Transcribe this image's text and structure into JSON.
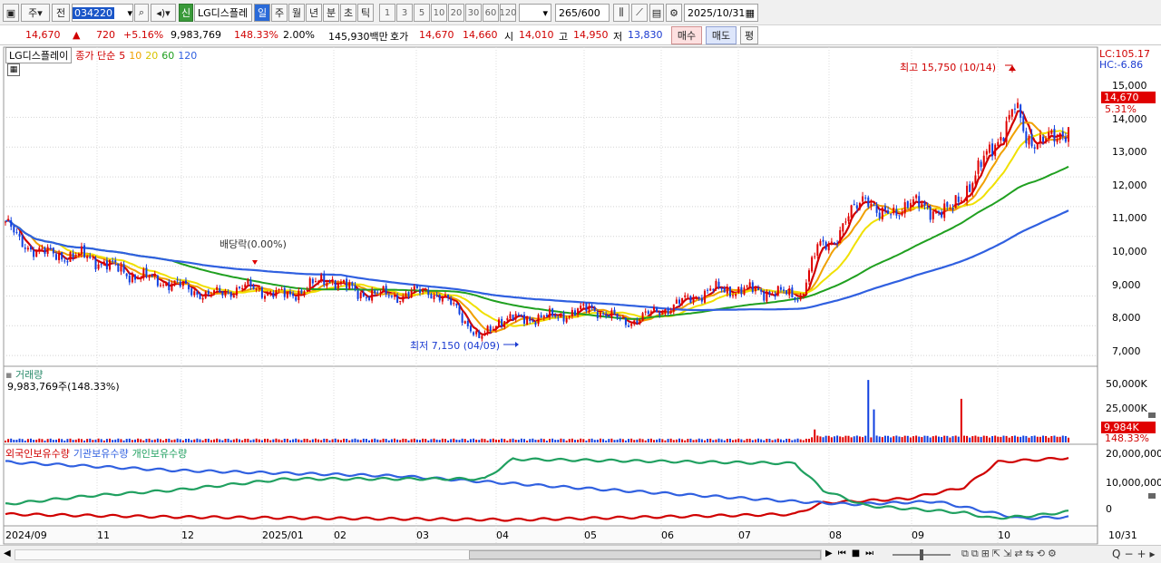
{
  "toolbar": {
    "period": "주",
    "prev": "전",
    "code": "034220",
    "name": "LG디스플레",
    "new_badge": "신",
    "periods": [
      "일",
      "주",
      "월",
      "년",
      "분",
      "초",
      "틱"
    ],
    "minutes": [
      "1",
      "3",
      "5",
      "10",
      "20",
      "30",
      "60",
      "120"
    ],
    "count": "265",
    "count_max": "/600",
    "date": "2025/10/31"
  },
  "quote": {
    "price": "14,670",
    "change_arrow": "▲",
    "change": "720",
    "change_pct": "+5.16%",
    "volume": "9,983,769",
    "vol_ratio": "148.33%",
    "turnover": "2.00%",
    "amount": "145,930백만",
    "ask_label": "호가",
    "ask": "14,670",
    "bid": "14,660",
    "open_label": "시",
    "open": "14,010",
    "high_label": "고",
    "high": "14,950",
    "low_label": "저",
    "low": "13,830",
    "buy": "매수",
    "sell": "매도",
    "avg": "평"
  },
  "price_panel": {
    "title": "LG디스플레이",
    "ma_label": "종가 단순",
    "ma_periods": [
      "5",
      "10",
      "20",
      "60",
      "120"
    ],
    "ma_colors": [
      "#d00000",
      "#f0a000",
      "#f0e000",
      "#20a020",
      "#3060e0"
    ],
    "lc": "LC:105.17",
    "hc": "HC:-6.86",
    "max_label": "최고 15,750 (10/14)",
    "min_label": "최저 7,150 (04/09)",
    "dividend_label": "배당락(0.00%)",
    "last_price": "14,670",
    "last_pct": "5.31%",
    "y_ticks": [
      "15,000",
      "14,000",
      "13,000",
      "12,000",
      "11,000",
      "10,000",
      "9,000",
      "8,000",
      "7,000"
    ]
  },
  "volume_panel": {
    "title": "거래량",
    "value": "9,983,769주(148.33%)",
    "y_ticks": [
      "50,000K",
      "25,000K",
      "0"
    ],
    "last": "9,984K",
    "last_pct": "148.33%"
  },
  "holding_panel": {
    "legend": [
      "외국인보유수량",
      "기관보유수량",
      "개인보유수량"
    ],
    "colors": [
      "#d00000",
      "#3060e0",
      "#20a060"
    ],
    "y_ticks": [
      "20,000,000",
      "10,000,000",
      "0"
    ]
  },
  "x_axis": {
    "labels": [
      "2024/09",
      "11",
      "12",
      "2025/01",
      "02",
      "03",
      "04",
      "05",
      "06",
      "07",
      "08",
      "09",
      "10",
      "10/31"
    ]
  },
  "chart_data": {
    "type": "candlestick",
    "price_range": [
      6700,
      16200
    ],
    "anchors": [
      [
        0,
        11500
      ],
      [
        5,
        10800
      ],
      [
        15,
        10400
      ],
      [
        30,
        10300
      ],
      [
        45,
        9700
      ],
      [
        60,
        9400
      ],
      [
        72,
        9000
      ],
      [
        85,
        9300
      ],
      [
        100,
        9000
      ],
      [
        115,
        9600
      ],
      [
        125,
        9100
      ],
      [
        140,
        9000
      ],
      [
        150,
        9200
      ],
      [
        160,
        8600
      ],
      [
        168,
        7500
      ],
      [
        175,
        8200
      ],
      [
        195,
        8300
      ],
      [
        208,
        8600
      ],
      [
        220,
        8100
      ],
      [
        235,
        8600
      ],
      [
        250,
        9200
      ],
      [
        265,
        9200
      ],
      [
        282,
        9000
      ],
      [
        288,
        10600
      ],
      [
        295,
        11000
      ],
      [
        305,
        12500
      ],
      [
        310,
        11600
      ],
      [
        320,
        12100
      ],
      [
        335,
        11800
      ],
      [
        345,
        13200
      ],
      [
        352,
        14300
      ],
      [
        358,
        15300
      ],
      [
        362,
        14300
      ],
      [
        372,
        14200
      ],
      [
        377,
        14670
      ]
    ],
    "n_bars": 378,
    "max": {
      "value": 15750,
      "date": "10/14"
    },
    "min": {
      "value": 7150,
      "date": "04/09"
    },
    "volume_spikes": [
      [
        287,
        11000
      ],
      [
        306,
        53000
      ],
      [
        308,
        28000
      ],
      [
        339,
        37000
      ]
    ],
    "holdings": {
      "foreign": [
        [
          0,
          -1500000
        ],
        [
          60,
          -2500000
        ],
        [
          180,
          -3500000
        ],
        [
          280,
          -1500000
        ],
        [
          290,
          2500000
        ],
        [
          320,
          4000000
        ],
        [
          340,
          8000000
        ],
        [
          352,
          17000000
        ],
        [
          378,
          18500000
        ]
      ],
      "institution": [
        [
          0,
          17000000
        ],
        [
          60,
          14000000
        ],
        [
          140,
          12000000
        ],
        [
          200,
          8000000
        ],
        [
          280,
          3000000
        ],
        [
          300,
          2000000
        ],
        [
          330,
          3000000
        ],
        [
          350,
          -1000000
        ],
        [
          360,
          -3000000
        ],
        [
          378,
          -2500000
        ]
      ],
      "individual": [
        [
          0,
          2000000
        ],
        [
          30,
          5000000
        ],
        [
          60,
          7000000
        ],
        [
          100,
          11000000
        ],
        [
          170,
          11000000
        ],
        [
          180,
          18000000
        ],
        [
          280,
          16500000
        ],
        [
          290,
          7000000
        ],
        [
          305,
          1500000
        ],
        [
          340,
          -1000000
        ],
        [
          350,
          -3000000
        ],
        [
          365,
          -2000000
        ],
        [
          378,
          -500000
        ]
      ]
    },
    "holding_range": [
      -5000000,
      22000000
    ]
  }
}
